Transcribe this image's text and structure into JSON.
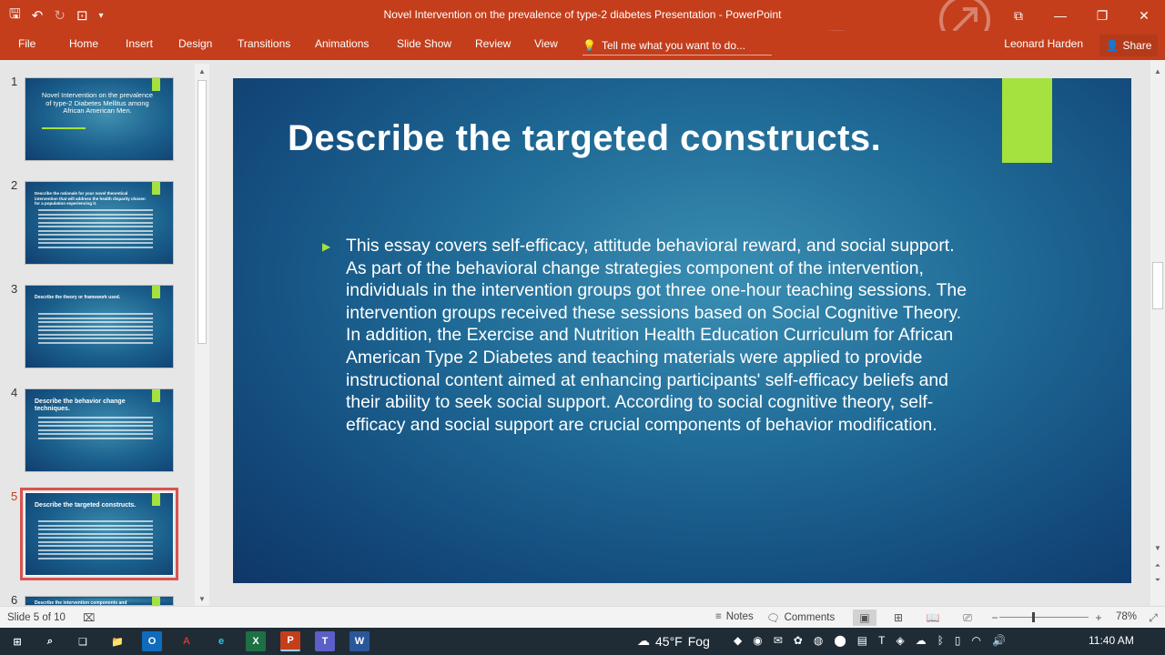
{
  "window": {
    "title": "Novel Intervention on the prevalence of type-2 diabetes Presentation - PowerPoint",
    "minimize": "—",
    "restore": "❐",
    "close": "✕",
    "ribbon_display": "⧉"
  },
  "ribbon": {
    "tabs": [
      "File",
      "Home",
      "Insert",
      "Design",
      "Transitions",
      "Animations",
      "Slide Show",
      "Review",
      "View"
    ],
    "tell_me": "Tell me what you want to do...",
    "user": "Leonard Harden",
    "share": "Share"
  },
  "thumbnails": [
    {
      "num": "1",
      "title": "Novel Intervention on the prevalence of type-2 Diabetes Mellitus among African American Men."
    },
    {
      "num": "2",
      "title": "Describe the rationale for your novel theoretical intervention that will address the health disparity chosen for a population experiencing it."
    },
    {
      "num": "3",
      "title": "Describe the theory or framework used."
    },
    {
      "num": "4",
      "title": "Describe the behavior change techniques."
    },
    {
      "num": "5",
      "title": "Describe the targeted constructs."
    },
    {
      "num": "6",
      "title": "Describe the intervention components and"
    }
  ],
  "slide": {
    "title": "Describe the targeted constructs.",
    "body": "This essay covers self-efficacy, attitude behavioral reward, and social support. As part of the behavioral change strategies component of the intervention, individuals in the intervention groups got three one-hour teaching sessions. The intervention groups received these sessions based on Social Cognitive Theory. In addition, the Exercise and Nutrition Health Education Curriculum for African American Type 2 Diabetes and teaching materials were applied to provide instructional content aimed at enhancing participants' self-efficacy beliefs and their ability to seek social support. According to social cognitive theory, self-efficacy and social support are crucial components of behavior modification."
  },
  "status": {
    "slide_info": "Slide 5 of 10",
    "notes": "Notes",
    "comments": "Comments",
    "zoom": "78%"
  },
  "taskbar": {
    "weather_temp": "45°F",
    "weather_desc": "Fog",
    "time": "11:40 AM"
  },
  "colors": {
    "accent": "#c43e1c",
    "slide_green": "#a5e13f"
  }
}
